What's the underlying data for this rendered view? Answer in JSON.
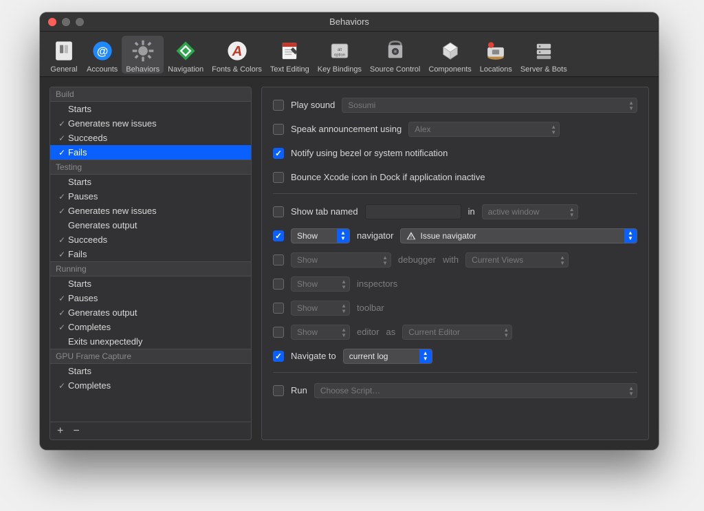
{
  "window": {
    "title": "Behaviors"
  },
  "toolbar": [
    {
      "id": "general",
      "label": "General"
    },
    {
      "id": "accounts",
      "label": "Accounts"
    },
    {
      "id": "behaviors",
      "label": "Behaviors",
      "selected": true
    },
    {
      "id": "navigation",
      "label": "Navigation"
    },
    {
      "id": "fonts-colors",
      "label": "Fonts & Colors"
    },
    {
      "id": "text-editing",
      "label": "Text Editing"
    },
    {
      "id": "key-bindings",
      "label": "Key Bindings"
    },
    {
      "id": "source-control",
      "label": "Source Control"
    },
    {
      "id": "components",
      "label": "Components"
    },
    {
      "id": "locations",
      "label": "Locations"
    },
    {
      "id": "server-bots",
      "label": "Server & Bots"
    }
  ],
  "sidebar": {
    "groups": [
      {
        "name": "Build",
        "items": [
          {
            "label": "Starts",
            "checked": false
          },
          {
            "label": "Generates new issues",
            "checked": true
          },
          {
            "label": "Succeeds",
            "checked": true
          },
          {
            "label": "Fails",
            "checked": true,
            "selected": true
          }
        ]
      },
      {
        "name": "Testing",
        "items": [
          {
            "label": "Starts",
            "checked": false
          },
          {
            "label": "Pauses",
            "checked": true
          },
          {
            "label": "Generates new issues",
            "checked": true
          },
          {
            "label": "Generates output",
            "checked": false
          },
          {
            "label": "Succeeds",
            "checked": true
          },
          {
            "label": "Fails",
            "checked": true
          }
        ]
      },
      {
        "name": "Running",
        "items": [
          {
            "label": "Starts",
            "checked": false
          },
          {
            "label": "Pauses",
            "checked": true
          },
          {
            "label": "Generates output",
            "checked": true
          },
          {
            "label": "Completes",
            "checked": true
          },
          {
            "label": "Exits unexpectedly",
            "checked": false
          }
        ]
      },
      {
        "name": "GPU Frame Capture",
        "items": [
          {
            "label": "Starts",
            "checked": false
          },
          {
            "label": "Completes",
            "checked": true
          }
        ]
      }
    ],
    "footer": {
      "add": "+",
      "remove": "−"
    }
  },
  "detail": {
    "play_sound": {
      "label": "Play sound",
      "value": "Sosumi",
      "checked": false
    },
    "speak": {
      "label": "Speak announcement using",
      "value": "Alex",
      "checked": false
    },
    "notify": {
      "label": "Notify using bezel or system notification",
      "checked": true
    },
    "bounce": {
      "label": "Bounce Xcode icon in Dock if application inactive",
      "checked": false
    },
    "show_tab": {
      "label": "Show tab named",
      "in_label": "in",
      "in_value": "active window",
      "checked": false
    },
    "navigator": {
      "checked": true,
      "mode": "Show",
      "label": "navigator",
      "value": "Issue navigator"
    },
    "debugger": {
      "checked": false,
      "mode": "Show",
      "label": "debugger",
      "with_label": "with",
      "value": "Current Views"
    },
    "inspectors": {
      "checked": false,
      "mode": "Show",
      "label": "inspectors"
    },
    "toolbar_row": {
      "checked": false,
      "mode": "Show",
      "label": "toolbar"
    },
    "editor": {
      "checked": false,
      "mode": "Show",
      "label": "editor",
      "as_label": "as",
      "value": "Current Editor"
    },
    "navigate": {
      "checked": true,
      "label": "Navigate to",
      "value": "current log"
    },
    "run": {
      "checked": false,
      "label": "Run",
      "value": "Choose Script…"
    }
  }
}
